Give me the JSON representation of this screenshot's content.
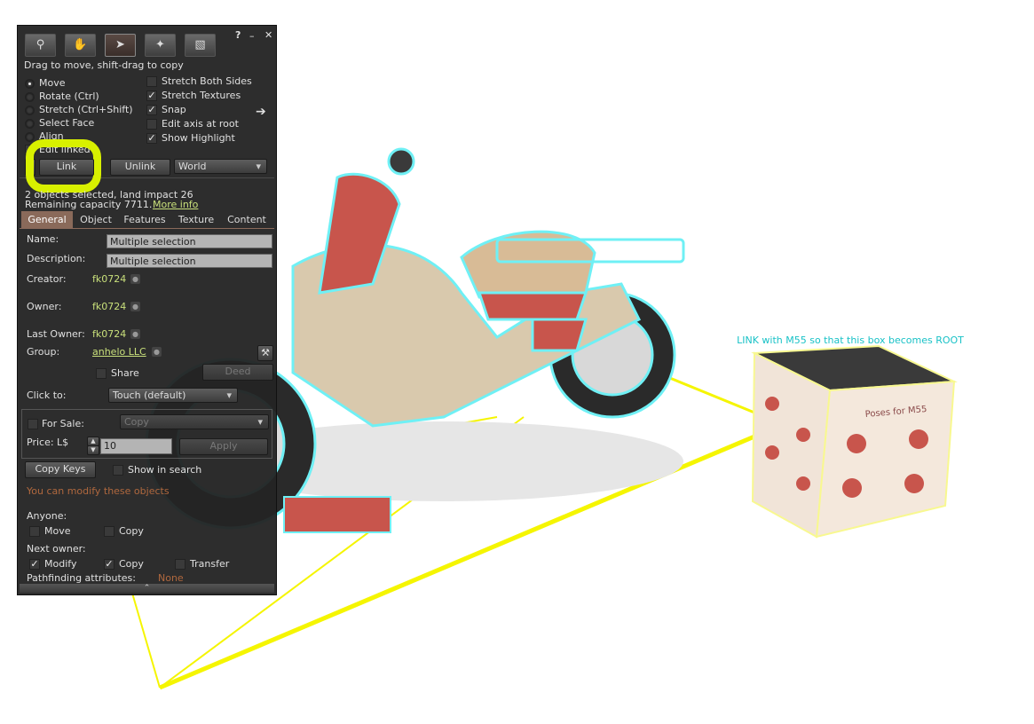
{
  "scene": {
    "cube_hover_text": "LINK with M55 so that this box becomes ROOT",
    "cube_title": "Poses for M55"
  },
  "panel": {
    "title_help": "?",
    "title_min": "–",
    "title_close": "✕",
    "hint": "Drag to move, shift-drag to copy",
    "modes": [
      {
        "label": "Move",
        "selected": true
      },
      {
        "label": "Rotate (Ctrl)",
        "selected": false
      },
      {
        "label": "Stretch (Ctrl+Shift)",
        "selected": false
      },
      {
        "label": "Select Face",
        "selected": false
      },
      {
        "label": "Align",
        "selected": false
      }
    ],
    "options": [
      {
        "label": "Stretch Both Sides",
        "checked": false
      },
      {
        "label": "Stretch Textures",
        "checked": true
      },
      {
        "label": "Snap",
        "checked": true
      },
      {
        "label": "Edit axis at root",
        "checked": false
      },
      {
        "label": "Show Highlight",
        "checked": true
      }
    ],
    "edit_linked": "Edit linked",
    "link_label": "Link",
    "unlink_label": "Unlink",
    "ruler_value": "World",
    "status_line1": "2 objects selected, land impact 26",
    "status_line2": "Remaining capacity 7711.",
    "more_info": "More info",
    "tabs": [
      "General",
      "Object",
      "Features",
      "Texture",
      "Content"
    ],
    "general": {
      "name_label": "Name:",
      "name_value": "Multiple selection",
      "desc_label": "Description:",
      "desc_value": "Multiple selection",
      "creator_label": "Creator:",
      "creator_value": "fk0724",
      "owner_label": "Owner:",
      "owner_value": "fk0724",
      "last_owner_label": "Last Owner:",
      "last_owner_value": "fk0724",
      "group_label": "Group:",
      "group_value": "anhelo LLC",
      "share_label": "Share",
      "deed_label": "Deed",
      "click_to_label": "Click to:",
      "click_to_value": "Touch  (default)",
      "for_sale_label": "For Sale:",
      "sale_type_value": "Copy",
      "price_label": "Price: L$",
      "price_value": "10",
      "apply_label": "Apply",
      "copy_keys_label": "Copy Keys",
      "show_in_search_label": "Show in search",
      "modify_notice": "You can modify these objects",
      "anyone_label": "Anyone:",
      "anyone_move": "Move",
      "anyone_copy": "Copy",
      "next_owner_label": "Next owner:",
      "next_modify": "Modify",
      "next_copy": "Copy",
      "next_transfer": "Transfer",
      "pathfinding_label": "Pathfinding attributes:",
      "pathfinding_value": "None"
    }
  }
}
